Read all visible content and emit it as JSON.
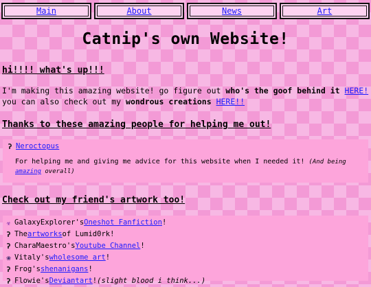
{
  "nav": {
    "main": "Main",
    "about": "About",
    "news": "News",
    "art": "Art"
  },
  "title": "Catnip's own Website!",
  "greeting": "hi!!!! what's up!!!",
  "intro": {
    "t1": "I'm making this amazing website! go figure out ",
    "b1": "who's the goof behind it",
    "l1": "HERE!",
    "t2": "you can also check out my ",
    "b2": "wondrous creations",
    "l2": "HERE!!"
  },
  "thanks_heading": "Thanks to these amazing people for helping me out!",
  "thanks": {
    "name": "Neroctopus",
    "text": "For helping me and giving me advice for this website when I needed it!",
    "aside_pre": "(And being ",
    "aside_link": "amazing",
    "aside_post": " overall)"
  },
  "friends_heading": "Check out my friend's artwork too!",
  "friends": [
    {
      "icon": "purple-cat-icon",
      "glyph": "☣",
      "pre": "GalaxyExplorer's ",
      "link": "Oneshot Fanfiction",
      "post": "!",
      "aside": ""
    },
    {
      "icon": "question-icon",
      "glyph": "ʔ",
      "pre": "The ",
      "link": "artworks",
      "post": " of Lumid0rk!",
      "aside": ""
    },
    {
      "icon": "question-icon",
      "glyph": "ʔ",
      "pre": "CharaMaestro's ",
      "link": "Youtube Channel",
      "post": "!",
      "aside": ""
    },
    {
      "icon": "bat-icon",
      "glyph": "❀",
      "pre": "Vitaly's ",
      "link": "wholesome art",
      "post": "!",
      "aside": ""
    },
    {
      "icon": "question-icon",
      "glyph": "ʔ",
      "pre": "Frog's ",
      "link": "shenanigans",
      "post": "!",
      "aside": ""
    },
    {
      "icon": "question-icon",
      "glyph": "ʔ",
      "pre": "Flowie's ",
      "link": "Deviantart",
      "post": "! ",
      "aside": "(slight blood i think...)"
    }
  ],
  "colors": {
    "bg_light": "#f7b8e4",
    "bg_dark": "#f39ad6",
    "panel": "#fda5db",
    "link": "#1a1aff"
  }
}
